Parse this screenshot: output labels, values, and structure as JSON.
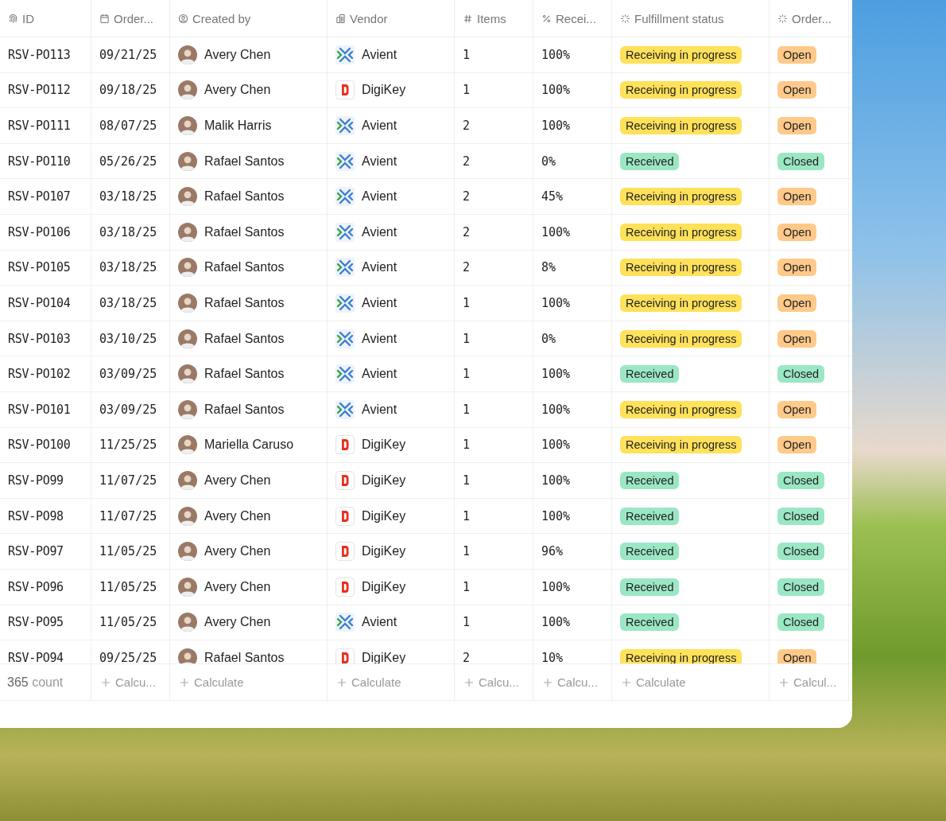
{
  "table": {
    "columns": [
      {
        "label": "ID",
        "kind": "id"
      },
      {
        "label": "Order...",
        "kind": "date"
      },
      {
        "label": "Created by",
        "kind": "person"
      },
      {
        "label": "Vendor",
        "kind": "company"
      },
      {
        "label": "Items",
        "kind": "number"
      },
      {
        "label": "Recei...",
        "kind": "percent"
      },
      {
        "label": "Fulfillment status",
        "kind": "status"
      },
      {
        "label": "Order...",
        "kind": "status"
      }
    ],
    "rows": [
      {
        "id": "RSV-PO113",
        "date": "09/21/25",
        "creator": "Avery Chen",
        "vendor": {
          "name": "Avient",
          "kind": "avient"
        },
        "items": "1",
        "received": "100%",
        "fulfillment": {
          "label": "Receiving in progress",
          "kind": "progress"
        },
        "order": {
          "label": "Open",
          "kind": "open"
        }
      },
      {
        "id": "RSV-PO112",
        "date": "09/18/25",
        "creator": "Avery Chen",
        "vendor": {
          "name": "DigiKey",
          "kind": "digikey"
        },
        "items": "1",
        "received": "100%",
        "fulfillment": {
          "label": "Receiving in progress",
          "kind": "progress"
        },
        "order": {
          "label": "Open",
          "kind": "open"
        }
      },
      {
        "id": "RSV-PO111",
        "date": "08/07/25",
        "creator": "Malik Harris",
        "vendor": {
          "name": "Avient",
          "kind": "avient"
        },
        "items": "2",
        "received": "100%",
        "fulfillment": {
          "label": "Receiving in progress",
          "kind": "progress"
        },
        "order": {
          "label": "Open",
          "kind": "open"
        }
      },
      {
        "id": "RSV-PO110",
        "date": "05/26/25",
        "creator": "Rafael Santos",
        "vendor": {
          "name": "Avient",
          "kind": "avient"
        },
        "items": "2",
        "received": "0%",
        "fulfillment": {
          "label": "Received",
          "kind": "received"
        },
        "order": {
          "label": "Closed",
          "kind": "closed"
        }
      },
      {
        "id": "RSV-PO107",
        "date": "03/18/25",
        "creator": "Rafael Santos",
        "vendor": {
          "name": "Avient",
          "kind": "avient"
        },
        "items": "2",
        "received": "45%",
        "fulfillment": {
          "label": "Receiving in progress",
          "kind": "progress"
        },
        "order": {
          "label": "Open",
          "kind": "open"
        }
      },
      {
        "id": "RSV-PO106",
        "date": "03/18/25",
        "creator": "Rafael Santos",
        "vendor": {
          "name": "Avient",
          "kind": "avient"
        },
        "items": "2",
        "received": "100%",
        "fulfillment": {
          "label": "Receiving in progress",
          "kind": "progress"
        },
        "order": {
          "label": "Open",
          "kind": "open"
        }
      },
      {
        "id": "RSV-PO105",
        "date": "03/18/25",
        "creator": "Rafael Santos",
        "vendor": {
          "name": "Avient",
          "kind": "avient"
        },
        "items": "2",
        "received": "8%",
        "fulfillment": {
          "label": "Receiving in progress",
          "kind": "progress"
        },
        "order": {
          "label": "Open",
          "kind": "open"
        }
      },
      {
        "id": "RSV-PO104",
        "date": "03/18/25",
        "creator": "Rafael Santos",
        "vendor": {
          "name": "Avient",
          "kind": "avient"
        },
        "items": "1",
        "received": "100%",
        "fulfillment": {
          "label": "Receiving in progress",
          "kind": "progress"
        },
        "order": {
          "label": "Open",
          "kind": "open"
        }
      },
      {
        "id": "RSV-PO103",
        "date": "03/10/25",
        "creator": "Rafael Santos",
        "vendor": {
          "name": "Avient",
          "kind": "avient"
        },
        "items": "1",
        "received": "0%",
        "fulfillment": {
          "label": "Receiving in progress",
          "kind": "progress"
        },
        "order": {
          "label": "Open",
          "kind": "open"
        }
      },
      {
        "id": "RSV-PO102",
        "date": "03/09/25",
        "creator": "Rafael Santos",
        "vendor": {
          "name": "Avient",
          "kind": "avient"
        },
        "items": "1",
        "received": "100%",
        "fulfillment": {
          "label": "Received",
          "kind": "received"
        },
        "order": {
          "label": "Closed",
          "kind": "closed"
        }
      },
      {
        "id": "RSV-PO101",
        "date": "03/09/25",
        "creator": "Rafael Santos",
        "vendor": {
          "name": "Avient",
          "kind": "avient"
        },
        "items": "1",
        "received": "100%",
        "fulfillment": {
          "label": "Receiving in progress",
          "kind": "progress"
        },
        "order": {
          "label": "Open",
          "kind": "open"
        }
      },
      {
        "id": "RSV-PO100",
        "date": "11/25/25",
        "creator": "Mariella Caruso",
        "vendor": {
          "name": "DigiKey",
          "kind": "digikey"
        },
        "items": "1",
        "received": "100%",
        "fulfillment": {
          "label": "Receiving in progress",
          "kind": "progress"
        },
        "order": {
          "label": "Open",
          "kind": "open"
        }
      },
      {
        "id": "RSV-PO99",
        "date": "11/07/25",
        "creator": "Avery Chen",
        "vendor": {
          "name": "DigiKey",
          "kind": "digikey"
        },
        "items": "1",
        "received": "100%",
        "fulfillment": {
          "label": "Received",
          "kind": "received"
        },
        "order": {
          "label": "Closed",
          "kind": "closed"
        }
      },
      {
        "id": "RSV-PO98",
        "date": "11/07/25",
        "creator": "Avery Chen",
        "vendor": {
          "name": "DigiKey",
          "kind": "digikey"
        },
        "items": "1",
        "received": "100%",
        "fulfillment": {
          "label": "Received",
          "kind": "received"
        },
        "order": {
          "label": "Closed",
          "kind": "closed"
        }
      },
      {
        "id": "RSV-PO97",
        "date": "11/05/25",
        "creator": "Avery Chen",
        "vendor": {
          "name": "DigiKey",
          "kind": "digikey"
        },
        "items": "1",
        "received": "96%",
        "fulfillment": {
          "label": "Received",
          "kind": "received"
        },
        "order": {
          "label": "Closed",
          "kind": "closed"
        }
      },
      {
        "id": "RSV-PO96",
        "date": "11/05/25",
        "creator": "Avery Chen",
        "vendor": {
          "name": "DigiKey",
          "kind": "digikey"
        },
        "items": "1",
        "received": "100%",
        "fulfillment": {
          "label": "Received",
          "kind": "received"
        },
        "order": {
          "label": "Closed",
          "kind": "closed"
        }
      },
      {
        "id": "RSV-PO95",
        "date": "11/05/25",
        "creator": "Avery Chen",
        "vendor": {
          "name": "Avient",
          "kind": "avient"
        },
        "items": "1",
        "received": "100%",
        "fulfillment": {
          "label": "Received",
          "kind": "received"
        },
        "order": {
          "label": "Closed",
          "kind": "closed"
        }
      },
      {
        "id": "RSV-PO94",
        "date": "09/25/25",
        "creator": "Rafael Santos",
        "vendor": {
          "name": "DigiKey",
          "kind": "digikey"
        },
        "items": "2",
        "received": "10%",
        "fulfillment": {
          "label": "Receiving in progress",
          "kind": "progress"
        },
        "order": {
          "label": "Open",
          "kind": "open"
        }
      }
    ],
    "footer": {
      "count": "**365** count",
      "calculate": [
        "Calcu...",
        "Calculate",
        "Calculate",
        "Calcu...",
        "Calcu...",
        "Calculate",
        "Calcul..."
      ]
    }
  }
}
